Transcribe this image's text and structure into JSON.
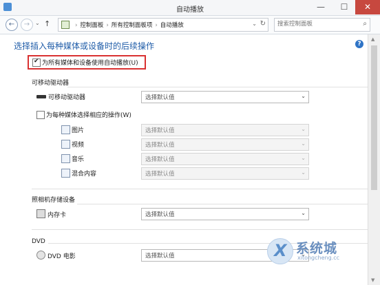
{
  "window": {
    "title": "自动播放",
    "minimize": "—",
    "maximize": "☐",
    "close": "✕"
  },
  "nav": {
    "back": "←",
    "forward": "→",
    "up": "↑",
    "recent": "⌄"
  },
  "address": {
    "crumbs": [
      "控制面板",
      "所有控制面板项",
      "自动播放"
    ],
    "separator": "›",
    "dropdown": "⌄",
    "refresh": "↻"
  },
  "search": {
    "placeholder": "搜索控制面板",
    "icon": "⌕"
  },
  "main": {
    "heading": "选择插入每种媒体或设备时的后续操作",
    "help_icon": "?",
    "master_checkbox": {
      "label": "为所有媒体和设备使用自动播放(U)",
      "checked": true
    }
  },
  "sections": {
    "removable": {
      "title": "可移动驱动器",
      "drive_label": "可移动驱动器",
      "drive_value": "选择默认值",
      "per_media_checkbox": {
        "label": "为每种媒体选择相应的操作(W)",
        "checked": false
      },
      "media": [
        {
          "label": "图片",
          "value": "选择默认值",
          "icon": "picture-icon"
        },
        {
          "label": "视频",
          "value": "选择默认值",
          "icon": "video-icon"
        },
        {
          "label": "音乐",
          "value": "选择默认值",
          "icon": "music-icon"
        },
        {
          "label": "混合内容",
          "value": "选择默认值",
          "icon": "mixed-content-icon"
        }
      ]
    },
    "camera": {
      "title": "照相机存储设备",
      "item_label": "内存卡",
      "item_value": "选择默认值"
    },
    "dvd": {
      "title": "DVD",
      "item_label": "DVD 电影",
      "item_value": "选择默认值"
    }
  },
  "dropdown_arrow": "⌄",
  "watermark": {
    "mark": "X",
    "text": "系统城",
    "url": "xitongcheng.cc"
  },
  "colors": {
    "heading": "#1f5ca8",
    "highlight_border": "#d93030",
    "close_button": "#c7483f"
  }
}
